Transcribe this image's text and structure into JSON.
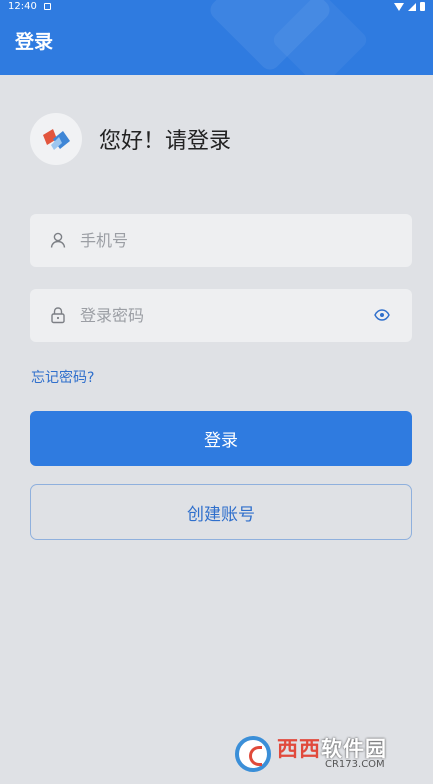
{
  "status_bar": {
    "time": "12:40"
  },
  "header": {
    "title": "登录"
  },
  "greeting": "您好！请登录",
  "phone_field": {
    "placeholder": "手机号",
    "value": ""
  },
  "password_field": {
    "placeholder": "登录密码",
    "value": ""
  },
  "forgot_password": "忘记密码?",
  "login_button": "登录",
  "create_account_button": "创建账号",
  "watermark": {
    "brand_red": "西西",
    "brand_white": "软件园",
    "site": "CR173.COM"
  },
  "colors": {
    "primary": "#2f7be0",
    "background": "#dfe1e5",
    "link": "#2f6fcc"
  },
  "icons": [
    "user-icon",
    "lock-icon",
    "eye-icon",
    "app-logo"
  ]
}
